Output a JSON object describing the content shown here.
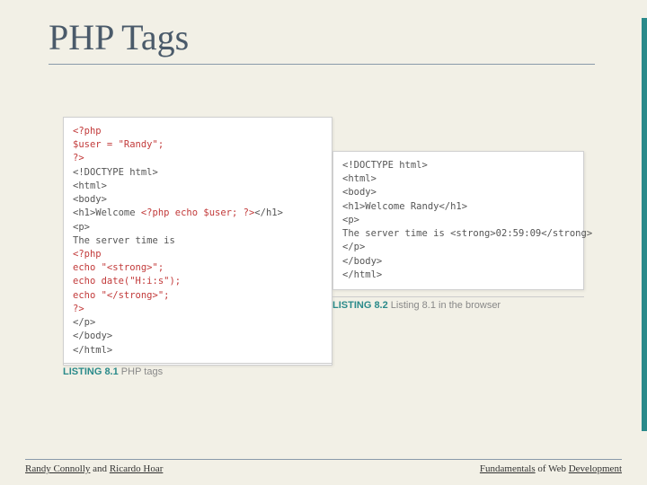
{
  "title": "PHP Tags",
  "code_left": {
    "l1": "<?php",
    "l2": "$user = \"Randy\";",
    "l3": "?>",
    "l4": "<!DOCTYPE html>",
    "l5": "<html>",
    "l6": "<body>",
    "l7a": "<h1>Welcome ",
    "l7b": "<?php echo $user; ?>",
    "l7c": "</h1>",
    "l8": "<p>",
    "l9": "The server time is",
    "l10": "<?php",
    "l11": "echo \"<strong>\";",
    "l12": "echo date(\"H:i:s\");",
    "l13": "echo \"</strong>\";",
    "l14": "?>",
    "l15": "</p>",
    "l16": "</body>",
    "l17": "</html>"
  },
  "code_right": {
    "l1": "<!DOCTYPE html>",
    "l2": "<html>",
    "l3": "<body>",
    "l4": "<h1>Welcome Randy</h1>",
    "l5": "<p>",
    "l6": "The server time is <strong>02:59:09</strong>",
    "l7": "</p>",
    "l8": "</body>",
    "l9": "</html>"
  },
  "captions": {
    "left_label": "LISTING 8.1",
    "left_text": " PHP tags",
    "right_label": "LISTING 8.2",
    "right_text": " Listing 8.1 in the browser"
  },
  "footer": {
    "a1": "Randy Connolly",
    "a2": " and ",
    "a3": "Ricardo Hoar",
    "b1": "Fundamentals",
    "b2": " of Web ",
    "b3": "Development"
  }
}
